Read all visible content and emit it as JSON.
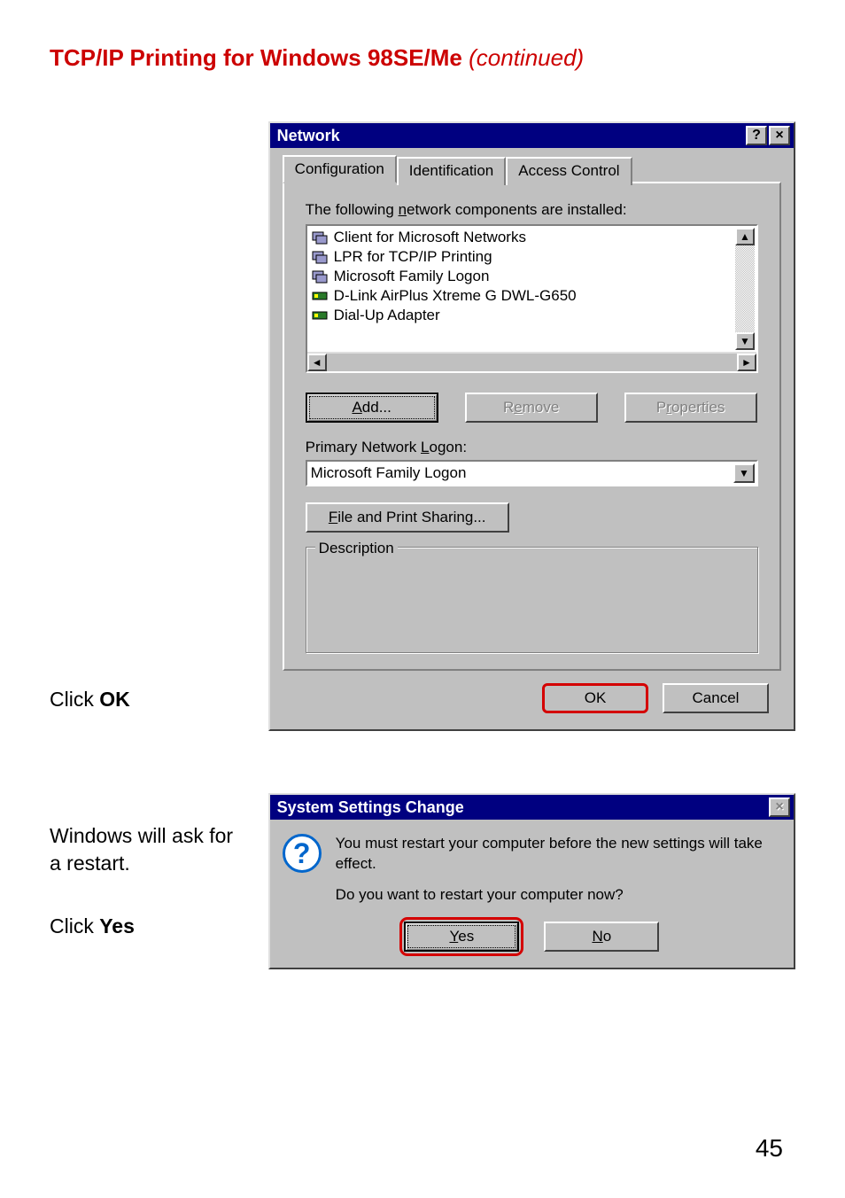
{
  "section_title_bold": "TCP/IP Printing for Windows 98SE/Me",
  "section_title_em": " (continued)",
  "left_click_ok_pre": "Click ",
  "left_click_ok_bold": "OK",
  "left_restart": "Windows will ask for a restart.",
  "left_click_yes_pre": "Click ",
  "left_click_yes_bold": "Yes",
  "page_number": "45",
  "network_dialog": {
    "title": "Network",
    "help_btn": "?",
    "close_btn": "×",
    "tabs": {
      "configuration": "Configuration",
      "identification": "Identification",
      "access": "Access Control"
    },
    "list_label_pre": "The following ",
    "list_label_u": "n",
    "list_label_post": "etwork components are installed:",
    "items": [
      "Client for Microsoft Networks",
      "LPR for TCP/IP Printing",
      "Microsoft Family Logon",
      "D-Link AirPlus Xtreme G DWL-G650",
      "Dial-Up Adapter"
    ],
    "add_u": "A",
    "add_rest": "dd...",
    "remove_u": "e",
    "remove_pre": "R",
    "remove_post": "move",
    "properties_u": "r",
    "properties_pre": "P",
    "properties_post": "operties",
    "primary_label_pre": "Primary Network ",
    "primary_label_u": "L",
    "primary_label_post": "ogon:",
    "primary_value": "Microsoft Family Logon",
    "fps_u": "F",
    "fps_rest": "ile and Print Sharing...",
    "description_label": "Description",
    "ok": "OK",
    "cancel": "Cancel"
  },
  "msgbox": {
    "title": "System Settings Change",
    "close_btn": "×",
    "line1": "You must restart your computer before the new settings will take effect.",
    "line2": "Do you want to restart your computer now?",
    "yes_u": "Y",
    "yes_rest": "es",
    "no_u": "N",
    "no_rest": "o"
  }
}
